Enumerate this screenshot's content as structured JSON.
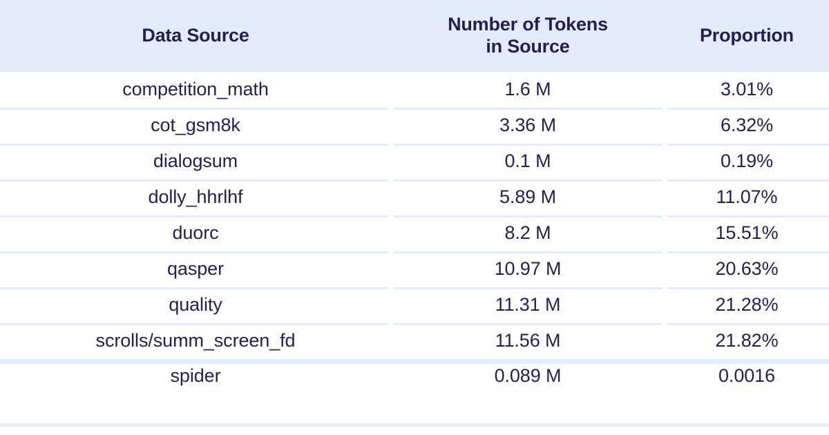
{
  "table": {
    "columns": [
      {
        "id": "data_source",
        "label": "Data Source",
        "label_line1": "Data Source",
        "label_line2": ""
      },
      {
        "id": "num_tokens",
        "label": "Number of Tokens in Source",
        "label_line1": "Number of Tokens",
        "label_line2": "in Source"
      },
      {
        "id": "proportion",
        "label": "Proportion",
        "label_line1": "Proportion",
        "label_line2": ""
      }
    ],
    "rows": [
      {
        "data_source": "competition_math",
        "num_tokens": "1.6 M",
        "proportion": "3.01%"
      },
      {
        "data_source": "cot_gsm8k",
        "num_tokens": "3.36 M",
        "proportion": "6.32%"
      },
      {
        "data_source": "dialogsum",
        "num_tokens": "0.1 M",
        "proportion": "0.19%"
      },
      {
        "data_source": "dolly_hhrlhf",
        "num_tokens": "5.89 M",
        "proportion": "11.07%"
      },
      {
        "data_source": "duorc",
        "num_tokens": "8.2 M",
        "proportion": "15.51%"
      },
      {
        "data_source": "qasper",
        "num_tokens": "10.97 M",
        "proportion": "20.63%"
      },
      {
        "data_source": "quality",
        "num_tokens": "11.31 M",
        "proportion": "21.28%"
      },
      {
        "data_source": "scrolls/summ_screen_fd",
        "num_tokens": "11.56 M",
        "proportion": "21.82%"
      },
      {
        "data_source": "spider",
        "num_tokens": "0.089 M",
        "proportion": "0.0016"
      }
    ]
  },
  "chart_data": {
    "type": "table",
    "title": "",
    "columns": [
      "Data Source",
      "Number of Tokens in Source",
      "Proportion"
    ],
    "categories": [
      "competition_math",
      "cot_gsm8k",
      "dialogsum",
      "dolly_hhrlhf",
      "duorc",
      "qasper",
      "quality",
      "scrolls/summ_screen_fd",
      "spider"
    ],
    "series": [
      {
        "name": "Number of Tokens in Source",
        "unit": "M",
        "values": [
          1.6,
          3.36,
          0.1,
          5.89,
          8.2,
          10.97,
          11.31,
          11.56,
          0.089
        ],
        "labels": [
          "1.6 M",
          "3.36 M",
          "0.1 M",
          "5.89 M",
          "8.2 M",
          "10.97 M",
          "11.31 M",
          "11.56 M",
          "0.089 M"
        ]
      },
      {
        "name": "Proportion",
        "unit": "%",
        "values": [
          3.01,
          6.32,
          0.19,
          11.07,
          15.51,
          20.63,
          21.28,
          21.82,
          0.0016
        ],
        "labels": [
          "3.01%",
          "6.32%",
          "0.19%",
          "11.07%",
          "15.51%",
          "20.63%",
          "21.28%",
          "21.82%",
          "0.0016"
        ]
      }
    ],
    "xlabel": "",
    "ylabel": "",
    "grid": true,
    "legend": "none"
  },
  "style": {
    "header_bg": "#e4ebfb",
    "text_color": "#241e52",
    "rule_color": "#e3ecfb",
    "row_bg": "#ffffff"
  }
}
